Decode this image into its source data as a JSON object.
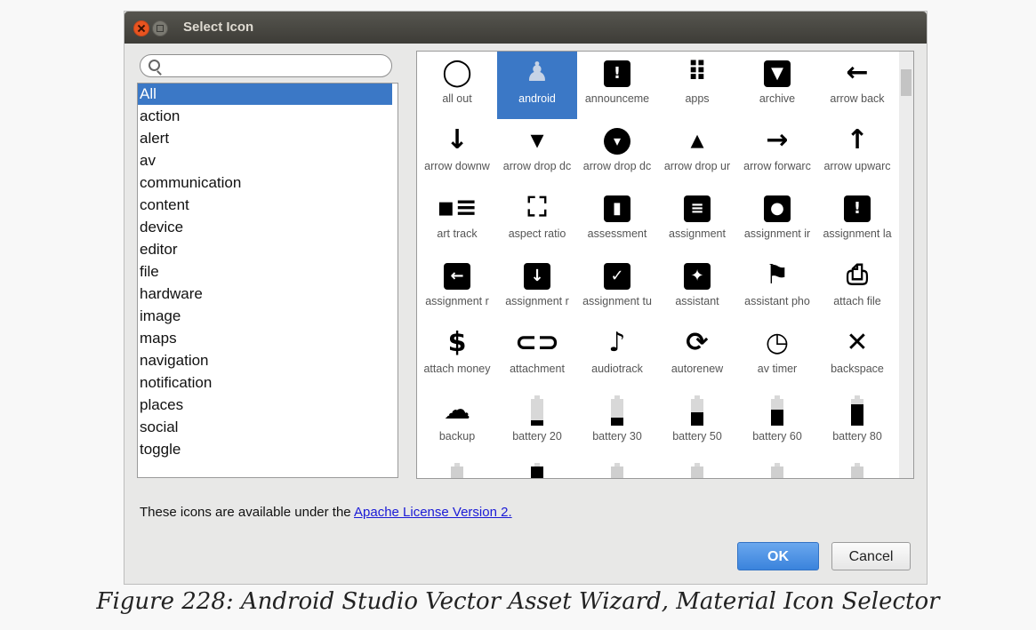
{
  "window": {
    "title": "Select Icon"
  },
  "search": {
    "value": "",
    "placeholder": ""
  },
  "categories": {
    "selected": "All",
    "items": [
      "All",
      "action",
      "alert",
      "av",
      "communication",
      "content",
      "device",
      "editor",
      "file",
      "hardware",
      "image",
      "maps",
      "navigation",
      "notification",
      "places",
      "social",
      "toggle"
    ]
  },
  "icons": {
    "selected": "android",
    "items": [
      {
        "label": "all out",
        "icon": "all-out-icon",
        "glyph": "◯"
      },
      {
        "label": "android",
        "icon": "android-icon",
        "glyph": "♟"
      },
      {
        "label": "announceme",
        "icon": "announcement-icon",
        "glyph": "!"
      },
      {
        "label": "apps",
        "icon": "apps-icon",
        "glyph": "⠿"
      },
      {
        "label": "archive",
        "icon": "archive-icon",
        "glyph": "▼"
      },
      {
        "label": "arrow back",
        "icon": "arrow-back-icon",
        "glyph": "←"
      },
      {
        "label": "arrow downw",
        "icon": "arrow-downward-icon",
        "glyph": "↓"
      },
      {
        "label": "arrow drop dc",
        "icon": "arrow-drop-down-icon",
        "glyph": "▾"
      },
      {
        "label": "arrow drop dc",
        "icon": "arrow-drop-down-circle-icon",
        "glyph": "▾"
      },
      {
        "label": "arrow drop ur",
        "icon": "arrow-drop-up-icon",
        "glyph": "▴"
      },
      {
        "label": "arrow forwarc",
        "icon": "arrow-forward-icon",
        "glyph": "→"
      },
      {
        "label": "arrow upwarc",
        "icon": "arrow-upward-icon",
        "glyph": "↑"
      },
      {
        "label": "art track",
        "icon": "art-track-icon",
        "glyph": "▪≡"
      },
      {
        "label": "aspect ratio",
        "icon": "aspect-ratio-icon",
        "glyph": "⛶"
      },
      {
        "label": "assessment",
        "icon": "assessment-icon",
        "glyph": "▮"
      },
      {
        "label": "assignment",
        "icon": "assignment-icon",
        "glyph": "≡"
      },
      {
        "label": "assignment ir",
        "icon": "assignment-ind-icon",
        "glyph": "●"
      },
      {
        "label": "assignment la",
        "icon": "assignment-late-icon",
        "glyph": "!"
      },
      {
        "label": "assignment r",
        "icon": "assignment-return-icon",
        "glyph": "←"
      },
      {
        "label": "assignment r",
        "icon": "assignment-returned-icon",
        "glyph": "↓"
      },
      {
        "label": "assignment tu",
        "icon": "assignment-turned-in-icon",
        "glyph": "✓"
      },
      {
        "label": "assistant",
        "icon": "assistant-icon",
        "glyph": "✦"
      },
      {
        "label": "assistant pho",
        "icon": "assistant-photo-icon",
        "glyph": "⚑"
      },
      {
        "label": "attach file",
        "icon": "attach-file-icon",
        "glyph": "⎙"
      },
      {
        "label": "attach money",
        "icon": "attach-money-icon",
        "glyph": "$"
      },
      {
        "label": "attachment",
        "icon": "attachment-icon",
        "glyph": "⊂⊃"
      },
      {
        "label": "audiotrack",
        "icon": "audiotrack-icon",
        "glyph": "♪"
      },
      {
        "label": "autorenew",
        "icon": "autorenew-icon",
        "glyph": "⟳"
      },
      {
        "label": "av timer",
        "icon": "av-timer-icon",
        "glyph": "◷"
      },
      {
        "label": "backspace",
        "icon": "backspace-icon",
        "glyph": "✕"
      },
      {
        "label": "backup",
        "icon": "backup-icon",
        "glyph": "☁"
      },
      {
        "label": "battery 20",
        "icon": "battery-20-icon",
        "level": 0.2
      },
      {
        "label": "battery 30",
        "icon": "battery-30-icon",
        "level": 0.3
      },
      {
        "label": "battery 50",
        "icon": "battery-50-icon",
        "level": 0.5
      },
      {
        "label": "battery 60",
        "icon": "battery-60-icon",
        "level": 0.6
      },
      {
        "label": "battery 80",
        "icon": "battery-80-icon",
        "level": 0.8
      }
    ]
  },
  "license": {
    "text": "These icons are available under the ",
    "link": "Apache License Version 2."
  },
  "buttons": {
    "ok": "OK",
    "cancel": "Cancel"
  },
  "caption": "Figure 228: Android Studio Vector Asset Wizard, Material Icon Selector",
  "colors": {
    "accent": "#3b78c6",
    "titlebar": "#3d3c37",
    "close": "#e95420"
  }
}
